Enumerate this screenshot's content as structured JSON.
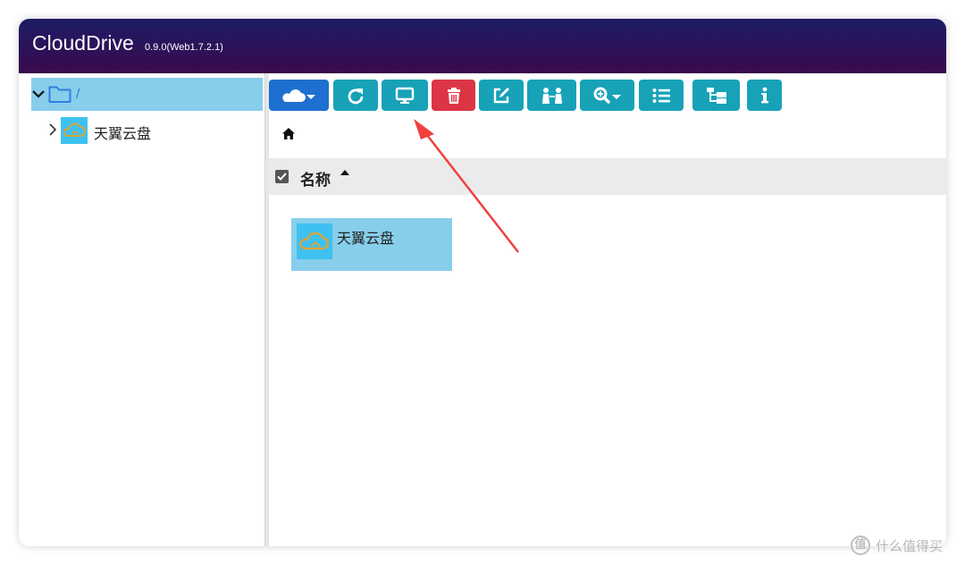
{
  "app": {
    "title": "CloudDrive",
    "version": "0.9.0(Web1.7.2.1)"
  },
  "sidebar": {
    "root_label": "/",
    "items": [
      {
        "label": "天翼云盘",
        "icon": "cloud-drive-icon"
      }
    ]
  },
  "toolbar": {
    "buttons": [
      {
        "name": "cloud-menu-button",
        "icon": "cloud-dropdown-icon"
      },
      {
        "name": "refresh-button",
        "icon": "refresh-icon"
      },
      {
        "name": "desktop-button",
        "icon": "desktop-icon"
      },
      {
        "name": "delete-button",
        "icon": "trash-icon"
      },
      {
        "name": "edit-button",
        "icon": "edit-icon"
      },
      {
        "name": "share-button",
        "icon": "users-icon"
      },
      {
        "name": "search-button",
        "icon": "search-dropdown-icon"
      },
      {
        "name": "list-view-button",
        "icon": "list-icon"
      },
      {
        "name": "tree-view-button",
        "icon": "tree-icon"
      },
      {
        "name": "info-button",
        "icon": "info-icon"
      }
    ]
  },
  "breadcrumb": {
    "icon": "home-icon"
  },
  "list": {
    "header_label": "名称",
    "items": [
      {
        "label": "天翼云盘",
        "icon": "cloud-drive-icon"
      }
    ]
  },
  "watermark": {
    "text": "什么值得买"
  },
  "colors": {
    "titlebar_start": "#1c1c66",
    "titlebar_end": "#3a0a4d",
    "toolbar_button": "#17a2b8",
    "primary_button": "#1f6fd0",
    "danger_button": "#dc3545",
    "selection": "#87ceeb",
    "annotation_arrow": "#f04040"
  }
}
